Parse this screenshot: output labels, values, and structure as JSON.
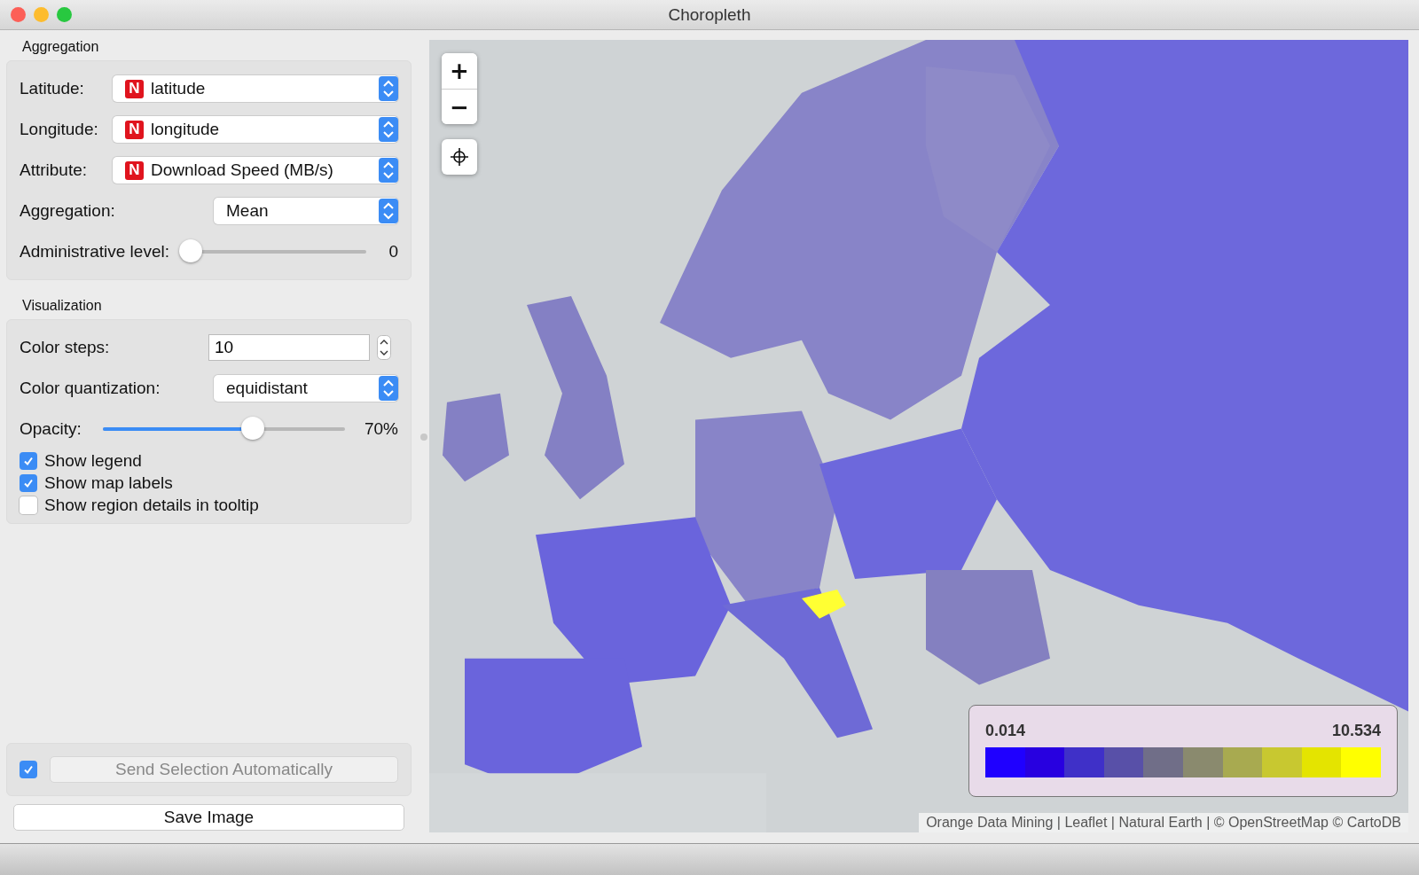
{
  "window": {
    "title": "Choropleth"
  },
  "aggregation": {
    "title": "Aggregation",
    "fields": [
      {
        "kind": "combo",
        "label": "Latitude:",
        "tag": "N",
        "value": "latitude"
      },
      {
        "kind": "combo",
        "label": "Longitude:",
        "tag": "N",
        "value": "longitude"
      },
      {
        "kind": "combo",
        "label": "Attribute:",
        "tag": "N",
        "value": "Download Speed (MB/s)"
      },
      {
        "kind": "short-combo",
        "label": "Aggregation:",
        "value": "Mean"
      }
    ],
    "admin_level": {
      "label": "Administrative level:",
      "level": 0,
      "reading": "0"
    }
  },
  "visualization": {
    "title": "Visualization",
    "color_steps": {
      "label": "Color steps:",
      "value": "10"
    },
    "color_quantization": {
      "label": "Color quantization:",
      "value": "equidistant"
    },
    "opacity": {
      "label": "Opacity:",
      "level": 0.62,
      "reading": "70%"
    },
    "checkboxes": [
      {
        "label": "Show legend",
        "checked": true
      },
      {
        "label": "Show map labels",
        "checked": true
      },
      {
        "label": "Show region details in tooltip",
        "checked": false
      }
    ]
  },
  "send": {
    "checked": true,
    "label": "Send Selection Automatically",
    "disabled": true
  },
  "save_button": "Save Image",
  "map": {
    "zoom_in": "+",
    "zoom_out": "−",
    "legend": {
      "min": "0.014",
      "max": "10.534",
      "swatches": [
        {
          "color": "#1f00ff"
        },
        {
          "color": "#2800e0"
        },
        {
          "color": "#3f30c8"
        },
        {
          "color": "#5850a8"
        },
        {
          "color": "#706e88"
        },
        {
          "color": "#8a8a6e"
        },
        {
          "color": "#a8aa50"
        },
        {
          "color": "#c8c830"
        },
        {
          "color": "#e4e400"
        },
        {
          "color": "#ffff00"
        }
      ]
    },
    "attribution": "Orange Data Mining | Leaflet | Natural Earth | © OpenStreetMap © CartoDB"
  }
}
